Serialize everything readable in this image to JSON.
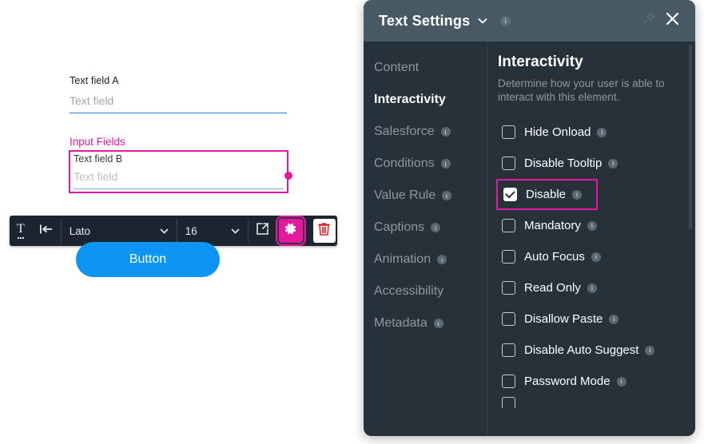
{
  "canvas": {
    "field_a": {
      "label": "Text field A",
      "placeholder": "Text field"
    },
    "selected_group": {
      "name": "Input Fields",
      "label": "Text field B",
      "placeholder": "Text field"
    },
    "button": {
      "label": "Button"
    },
    "toolbar": {
      "text_format_icon": "text-format-icon",
      "align_icon": "align-left-icon",
      "font_family": "Lato",
      "font_size": "16",
      "open_external_icon": "open-external-icon",
      "settings_icon": "gear-icon",
      "delete_icon": "trash-icon"
    },
    "colors": {
      "accent_magenta": "#E6189E",
      "button_blue": "#0D94F4",
      "underline_blue": "#2A7FD4",
      "toolbar_dark": "#1C2430"
    }
  },
  "panel": {
    "title": "Text Settings",
    "title_info": "i",
    "pin_icon": "pin-icon",
    "close_icon": "close-icon",
    "chevron_icon": "chevron-down-icon",
    "nav": [
      {
        "label": "Content",
        "active": false,
        "info": false
      },
      {
        "label": "Interactivity",
        "active": true,
        "info": false
      },
      {
        "label": "Salesforce",
        "active": false,
        "info": true
      },
      {
        "label": "Conditions",
        "active": false,
        "info": true
      },
      {
        "label": "Value Rule",
        "active": false,
        "info": true
      },
      {
        "label": "Captions",
        "active": false,
        "info": true
      },
      {
        "label": "Animation",
        "active": false,
        "info": true
      },
      {
        "label": "Accessibility",
        "active": false,
        "info": false
      },
      {
        "label": "Metadata",
        "active": false,
        "info": true
      }
    ],
    "content": {
      "heading": "Interactivity",
      "subtitle": "Determine how your user is able to interact with this element.",
      "options": [
        {
          "label": "Hide Onload",
          "checked": false,
          "info": true,
          "highlighted": false
        },
        {
          "label": "Disable Tooltip",
          "checked": false,
          "info": true,
          "highlighted": false
        },
        {
          "label": "Disable",
          "checked": true,
          "info": true,
          "highlighted": true
        },
        {
          "label": "Mandatory",
          "checked": false,
          "info": true,
          "highlighted": false
        },
        {
          "label": "Auto Focus",
          "checked": false,
          "info": true,
          "highlighted": false
        },
        {
          "label": "Read Only",
          "checked": false,
          "info": true,
          "highlighted": false
        },
        {
          "label": "Disallow Paste",
          "checked": false,
          "info": true,
          "highlighted": false
        },
        {
          "label": "Disable Auto Suggest",
          "checked": false,
          "info": true,
          "highlighted": false
        },
        {
          "label": "Password Mode",
          "checked": false,
          "info": true,
          "highlighted": false
        }
      ]
    },
    "colors": {
      "panel_bg": "#27313A",
      "header_bg": "#485963",
      "nav_inactive": "#8D98A1",
      "highlight": "#E6189E"
    }
  }
}
